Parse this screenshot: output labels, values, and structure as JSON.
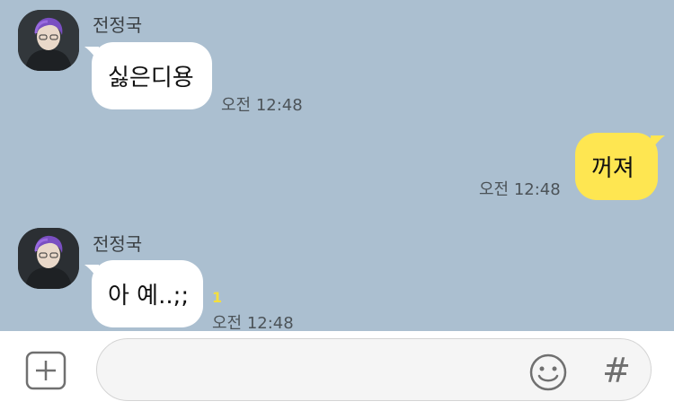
{
  "messages": [
    {
      "sender": "전정국",
      "text": "싫은디용",
      "time": "오전 12:48"
    },
    {
      "text": "꺼져",
      "time": "오전 12:48"
    },
    {
      "sender": "전정국",
      "text": "아 예..;;",
      "time": "오전 12:48",
      "unread": "1"
    }
  ],
  "input": {
    "placeholder": "",
    "hash_label": "#"
  },
  "icons": {
    "attach": "plus-square-icon",
    "emoji": "smiley-icon",
    "hashtag": "hash-icon"
  },
  "colors": {
    "chat_bg": "#abbfd0",
    "outgoing_bubble": "#fee651",
    "incoming_bubble": "#ffffff",
    "unread": "#f5df3c"
  }
}
